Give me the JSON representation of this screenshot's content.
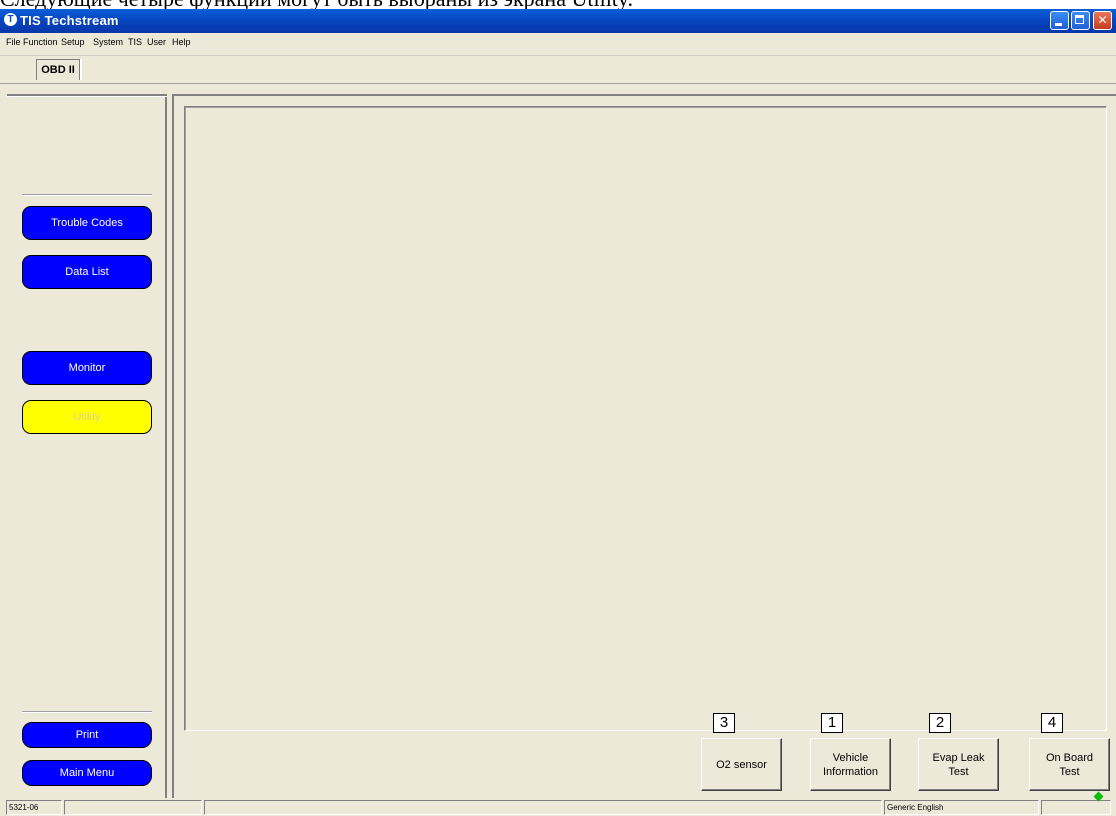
{
  "caption": "Следующие четыре функции могут быть выбраны из экрана Utility.",
  "window": {
    "title": "TIS Techstream",
    "title_icon": "T"
  },
  "menu": [
    "File",
    "Function",
    "Setup",
    "System",
    "TIS",
    "User",
    "Help"
  ],
  "tab": {
    "label": "OBD II"
  },
  "sidebar": {
    "trouble_codes": "Trouble Codes",
    "data_list": "Data List",
    "monitor": "Monitor",
    "utility": "Utility",
    "print": "Print",
    "main_menu": "Main Menu",
    "active_item": "Utility"
  },
  "actions": [
    {
      "number": "3",
      "label": "O2 sensor"
    },
    {
      "number": "1",
      "label": "Vehicle\nInformation"
    },
    {
      "number": "2",
      "label": "Evap Leak\nTest"
    },
    {
      "number": "4",
      "label": "On Board\nTest"
    }
  ],
  "status": {
    "code": "5321-06",
    "language": "Generic English",
    "indicator_color": "#00c000"
  },
  "colors": {
    "title_bar": "#0846c2",
    "sidebar_button": "#0000ff",
    "active_button": "#ffff00"
  }
}
